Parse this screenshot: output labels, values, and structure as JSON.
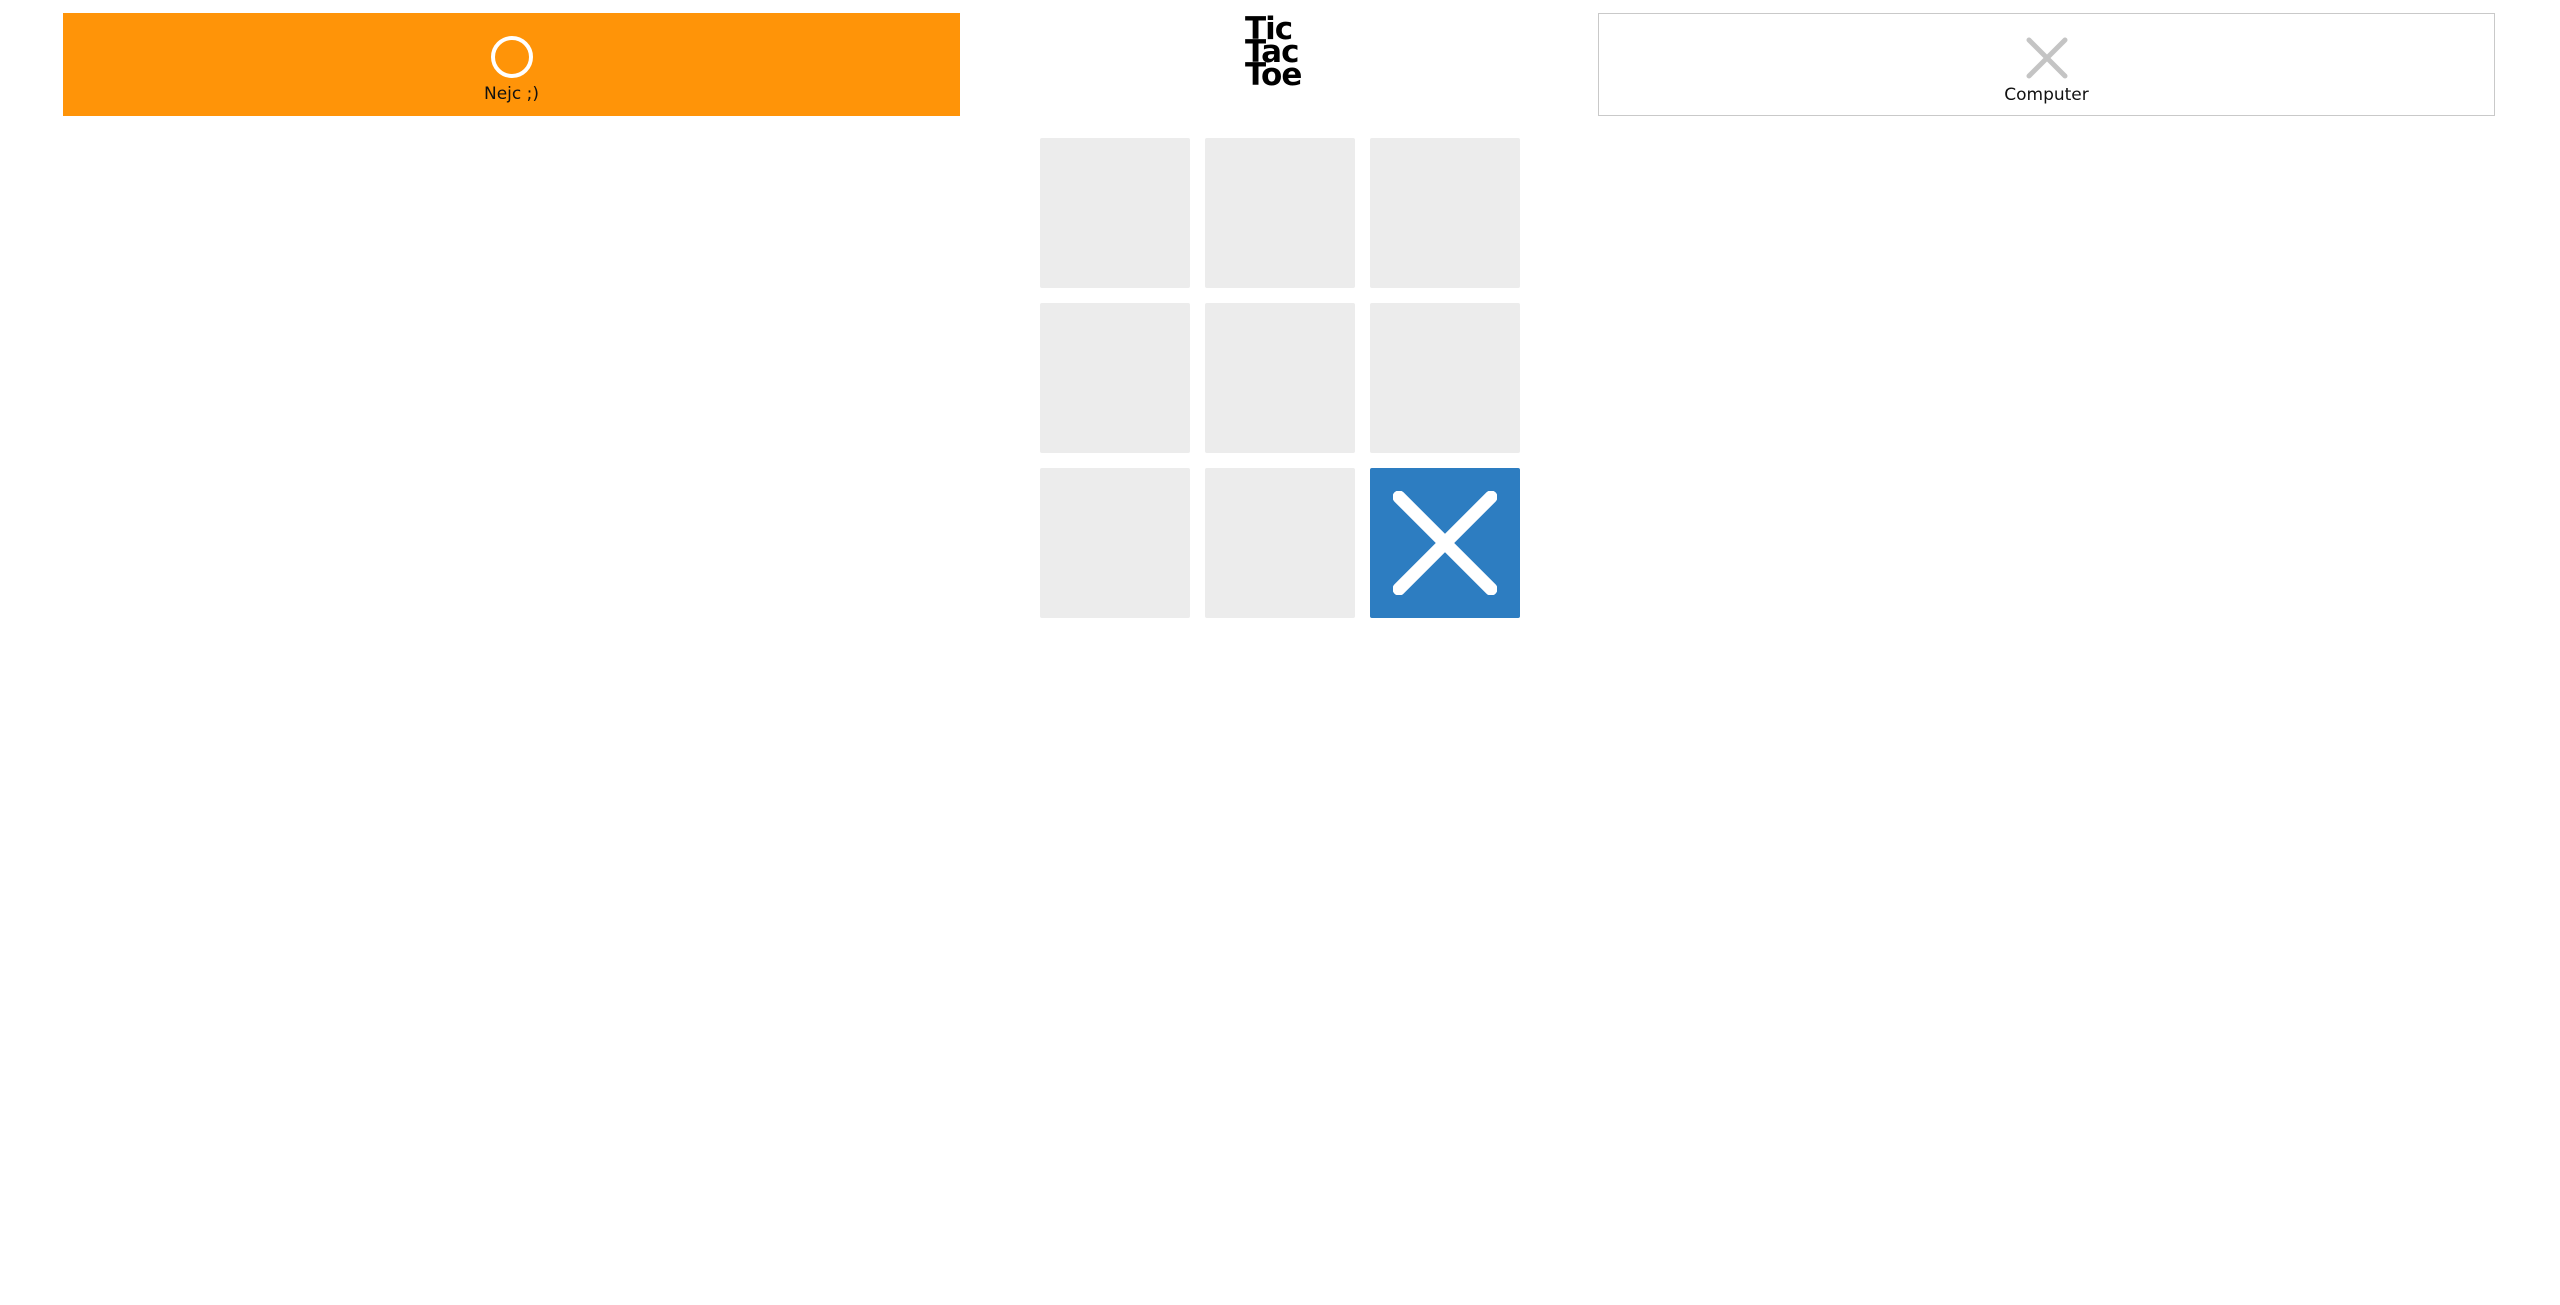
{
  "logo": {
    "line1": "Tic",
    "line2": "Tac",
    "line3": "Toe"
  },
  "players": {
    "left": {
      "name": "Nejc ;)",
      "mark": "circle-icon",
      "active": true,
      "color": "#ff9408"
    },
    "right": {
      "name": "Computer",
      "mark": "cross-icon",
      "active": false,
      "color": "#c4c4c4"
    }
  },
  "board": {
    "cells": [
      "",
      "",
      "",
      "",
      "",
      "",
      "",
      "",
      "X"
    ],
    "cell_color": "#ececec",
    "filled_color": "#2d7dc1"
  }
}
